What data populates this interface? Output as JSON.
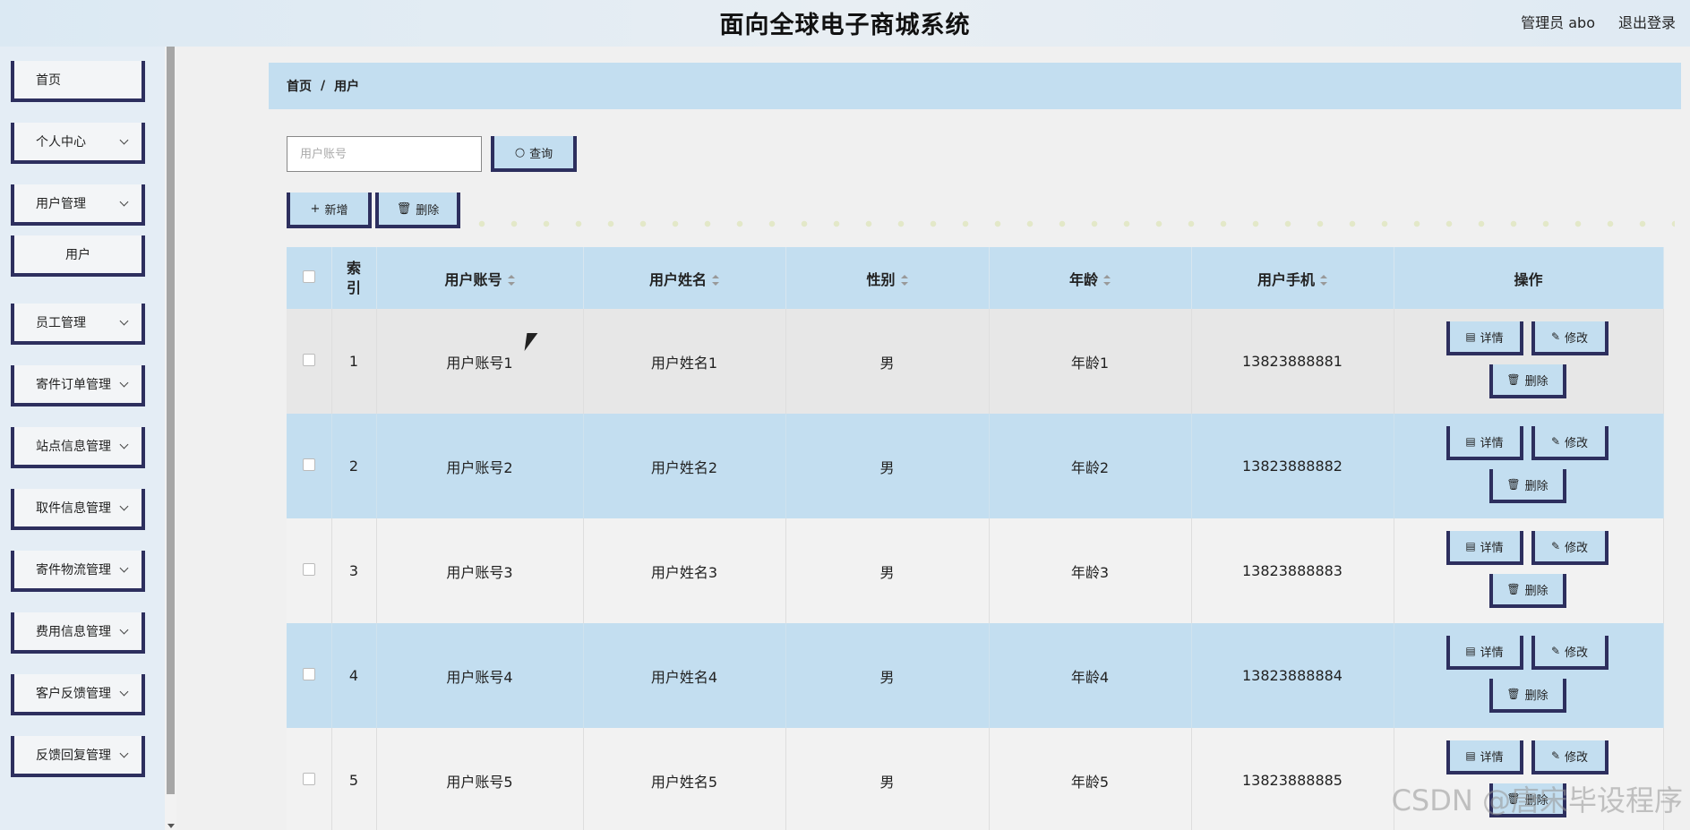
{
  "header": {
    "title": "面向全球电子商城系统",
    "admin": "管理员 abo",
    "logout": "退出登录"
  },
  "sidebar": {
    "items": [
      {
        "label": "首页"
      },
      {
        "label": "个人中心"
      },
      {
        "label": "用户管理"
      },
      {
        "label": "用户"
      },
      {
        "label": "员工管理"
      },
      {
        "label": "寄件订单管理"
      },
      {
        "label": "站点信息管理"
      },
      {
        "label": "取件信息管理"
      },
      {
        "label": "寄件物流管理"
      },
      {
        "label": "费用信息管理"
      },
      {
        "label": "客户反馈管理"
      },
      {
        "label": "反馈回复管理"
      }
    ]
  },
  "breadcrumb": {
    "home": "首页",
    "sep": "/",
    "current": "用户"
  },
  "search": {
    "placeholder": "用户账号",
    "button": "查询"
  },
  "toolbar": {
    "add": "新增",
    "delete": "删除"
  },
  "table": {
    "headers": [
      "索引",
      "用户账号",
      "用户姓名",
      "性别",
      "年龄",
      "用户手机",
      "操作"
    ],
    "rows": [
      {
        "index": "1",
        "account": "用户账号1",
        "name": "用户姓名1",
        "gender": "男",
        "age": "年龄1",
        "phone": "13823888881"
      },
      {
        "index": "2",
        "account": "用户账号2",
        "name": "用户姓名2",
        "gender": "男",
        "age": "年龄2",
        "phone": "13823888882"
      },
      {
        "index": "3",
        "account": "用户账号3",
        "name": "用户姓名3",
        "gender": "男",
        "age": "年龄3",
        "phone": "13823888883"
      },
      {
        "index": "4",
        "account": "用户账号4",
        "name": "用户姓名4",
        "gender": "男",
        "age": "年龄4",
        "phone": "13823888884"
      },
      {
        "index": "5",
        "account": "用户账号5",
        "name": "用户姓名5",
        "gender": "男",
        "age": "年龄5",
        "phone": "13823888885"
      }
    ],
    "actions": {
      "detail": "详情",
      "edit": "修改",
      "delete": "删除"
    }
  },
  "watermark": "CSDN @唐宋毕设程序",
  "colors": {
    "accent": "#c3def0",
    "border": "#2d2f5e"
  }
}
